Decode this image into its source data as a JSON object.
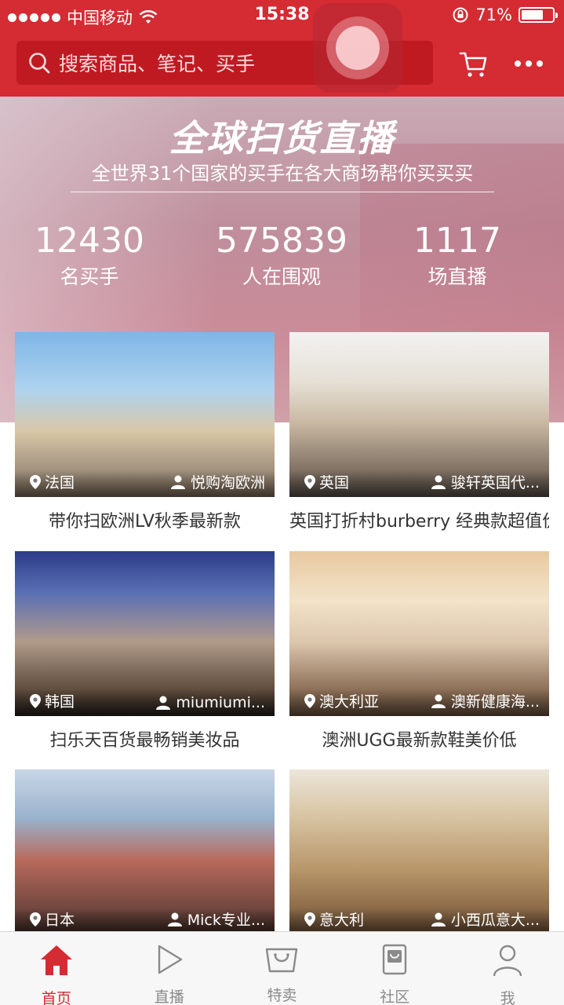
{
  "status_bar": {
    "carrier": "中国移动",
    "time": "15:38",
    "battery": "71%",
    "battery_level": 0.71
  },
  "header": {
    "search_placeholder": "搜索商品、笔记、买手",
    "cart_icon": "cart-icon",
    "more_icon": "more-dots-icon"
  },
  "banner": {
    "title": "全球扫货直播",
    "subtitle": "全世界31个国家的买手在各大商场帮你买买买",
    "stats": [
      {
        "value": "12430",
        "label": "名买手"
      },
      {
        "value": "575839",
        "label": "人在围观"
      },
      {
        "value": "1117",
        "label": "场直播"
      }
    ]
  },
  "cards": [
    {
      "country": "法国",
      "buyer": "悦购淘欧洲",
      "caption": "带你扫欧洲LV秋季最新款"
    },
    {
      "country": "英国",
      "buyer": "骏轩英国代...",
      "caption": "英国打折村burberry 经典款超值价"
    },
    {
      "country": "韩国",
      "buyer": "miumiumi...",
      "caption": "扫乐天百货最畅销美妆品"
    },
    {
      "country": "澳大利亚",
      "buyer": "澳新健康海...",
      "caption": "澳洲UGG最新款鞋美价低"
    },
    {
      "country": "日本",
      "buyer": "Mick专业...",
      "caption": ""
    },
    {
      "country": "意大利",
      "buyer": "小西瓜意大...",
      "caption": ""
    }
  ],
  "tabbar": {
    "tabs": [
      {
        "label": "首页",
        "icon": "home-icon",
        "active": true
      },
      {
        "label": "直播",
        "icon": "play-icon",
        "active": false
      },
      {
        "label": "特卖",
        "icon": "shopping-bag-icon",
        "active": false
      },
      {
        "label": "社区",
        "icon": "community-icon",
        "active": false
      },
      {
        "label": "我",
        "icon": "profile-icon",
        "active": false
      }
    ]
  },
  "colors": {
    "brand_red": "#d52b33",
    "search_bg": "#bf1a22",
    "tab_inactive": "#8a8a8a"
  }
}
